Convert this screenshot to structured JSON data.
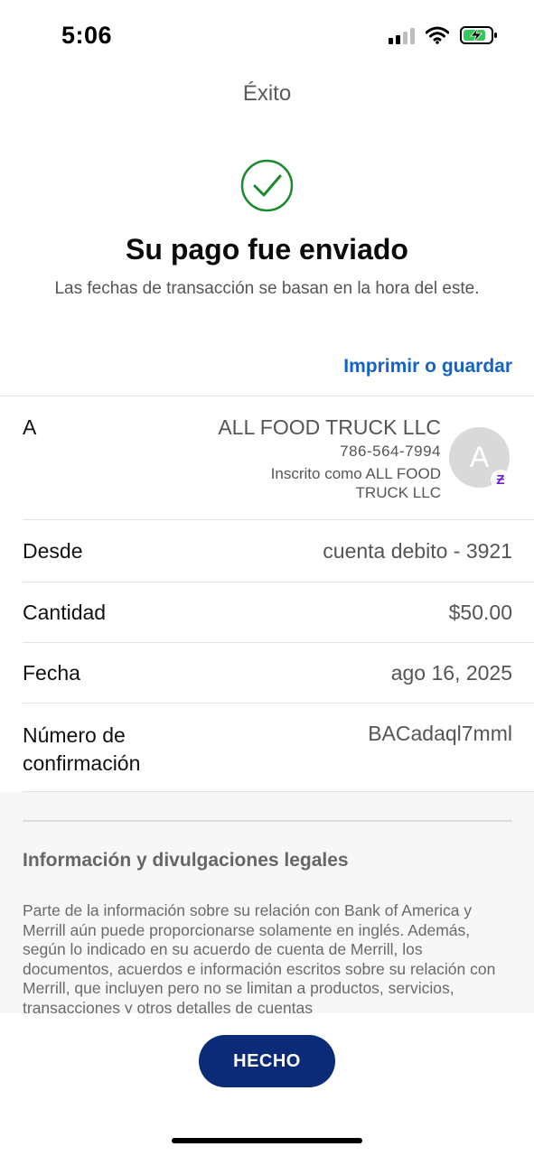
{
  "status_bar": {
    "time": "5:06"
  },
  "header": {
    "title": "Éxito"
  },
  "confirmation": {
    "headline": "Su pago fue enviado",
    "subline": "Las fechas de transacción se basan en la hora del este.",
    "print_link": "Imprimir o guardar"
  },
  "recipient": {
    "label": "A",
    "name": "ALL FOOD TRUCK LLC",
    "phone": "786-564-7994",
    "enrolled_as": "Inscrito como ALL FOOD TRUCK LLC",
    "avatar_initial": "A",
    "badge_glyph": "Ƶ"
  },
  "details": {
    "from_label": "Desde",
    "from_value": "cuenta debito - 3921",
    "amount_label": "Cantidad",
    "amount_value": "$50.00",
    "date_label": "Fecha",
    "date_value": "ago 16, 2025",
    "confirmation_label": "Número de confirmación",
    "confirmation_value": "BACadaql7mml"
  },
  "legal": {
    "title": "Información y divulgaciones legales",
    "body": "Parte de la información sobre su relación con Bank of America y Merrill aún puede proporcionarse solamente en inglés. Además, según lo indicado en su acuerdo de cuenta de Merrill, los documentos, acuerdos e información escritos sobre su relación con Merrill, que incluyen pero no se limitan a productos, servicios, transacciones y otros detalles de cuentas"
  },
  "footer": {
    "done_label": "HECHO"
  },
  "colors": {
    "accent_link": "#1464c8",
    "success_green": "#1a8a2a",
    "primary_button": "#0b2a78",
    "zelle_purple": "#6d1ed4"
  },
  "icons": {
    "signal": "cellular-signal-icon",
    "wifi": "wifi-icon",
    "battery": "battery-charging-icon",
    "success": "check-circle-icon",
    "zelle": "zelle-icon"
  }
}
